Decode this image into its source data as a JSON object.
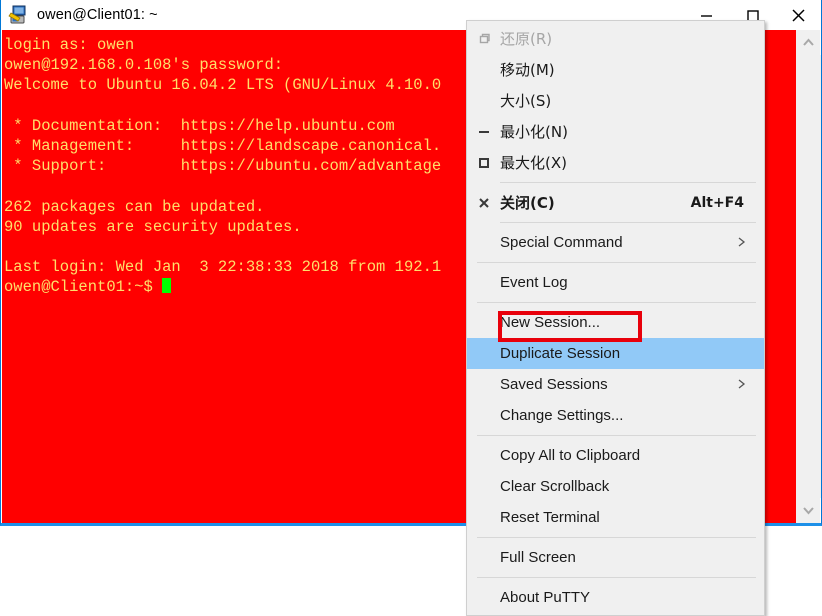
{
  "window": {
    "title": "owen@Client01: ~",
    "icon": "putty-computer-icon",
    "border_color": "#1e90e8",
    "titlebar_buttons": [
      {
        "name": "minimize-button",
        "glyph": "minimize-icon"
      },
      {
        "name": "maximize-button",
        "glyph": "maximize-icon"
      },
      {
        "name": "close-button",
        "glyph": "close-icon"
      }
    ]
  },
  "terminal": {
    "background_color": "#ff0000",
    "foreground_color": "#ffdf6b",
    "cursor_color": "#00ff00",
    "lines": [
      "login as: owen",
      "owen@192.168.0.108's password:",
      "Welcome to Ubuntu 16.04.2 LTS (GNU/Linux 4.10.0",
      "",
      " * Documentation:  https://help.ubuntu.com",
      " * Management:     https://landscape.canonical.",
      " * Support:        https://ubuntu.com/advantage",
      "",
      "262 packages can be updated.",
      "90 updates are security updates.",
      "",
      "Last login: Wed Jan  3 22:38:33 2018 from 192.1"
    ],
    "prompt": "owen@Client01:~$ "
  },
  "scrollbar": {
    "up_arrow": "chevron-up-icon",
    "down_arrow": "chevron-down-icon"
  },
  "context_menu": {
    "highlight_color": "#91c9f7",
    "items": [
      {
        "label": "还原(R)",
        "glyph": "restore-icon",
        "accel": "",
        "submenu": false,
        "disabled": true,
        "highlight": false,
        "zh": true
      },
      {
        "label": "移动(M)",
        "glyph": "",
        "accel": "",
        "submenu": false,
        "disabled": false,
        "highlight": false,
        "zh": true
      },
      {
        "label": "大小(S)",
        "glyph": "",
        "accel": "",
        "submenu": false,
        "disabled": false,
        "highlight": false,
        "zh": true
      },
      {
        "label": "最小化(N)",
        "glyph": "minimize-icon",
        "accel": "",
        "submenu": false,
        "disabled": false,
        "highlight": false,
        "zh": true
      },
      {
        "label": "最大化(X)",
        "glyph": "maximize-icon",
        "accel": "",
        "submenu": false,
        "disabled": false,
        "highlight": false,
        "zh": true
      },
      {
        "separator": true
      },
      {
        "label": "关闭(C)",
        "glyph": "close-icon",
        "accel": "Alt+F4",
        "submenu": false,
        "disabled": false,
        "highlight": false,
        "zh": true,
        "bold": true
      },
      {
        "separator": true
      },
      {
        "label": "Special Command",
        "glyph": "",
        "accel": "",
        "submenu": true,
        "disabled": false,
        "highlight": false
      },
      {
        "separator": true
      },
      {
        "label": "Event Log",
        "glyph": "",
        "accel": "",
        "submenu": false,
        "disabled": false,
        "highlight": false
      },
      {
        "separator": true
      },
      {
        "label": "New Session...",
        "glyph": "",
        "accel": "",
        "submenu": false,
        "disabled": false,
        "highlight": false
      },
      {
        "label": "Duplicate Session",
        "glyph": "",
        "accel": "",
        "submenu": false,
        "disabled": false,
        "highlight": true
      },
      {
        "label": "Saved Sessions",
        "glyph": "",
        "accel": "",
        "submenu": true,
        "disabled": false,
        "highlight": false
      },
      {
        "label": "Change Settings...",
        "glyph": "",
        "accel": "",
        "submenu": false,
        "disabled": false,
        "highlight": false
      },
      {
        "separator": true
      },
      {
        "label": "Copy All to Clipboard",
        "glyph": "",
        "accel": "",
        "submenu": false,
        "disabled": false,
        "highlight": false
      },
      {
        "label": "Clear Scrollback",
        "glyph": "",
        "accel": "",
        "submenu": false,
        "disabled": false,
        "highlight": false
      },
      {
        "label": "Reset Terminal",
        "glyph": "",
        "accel": "",
        "submenu": false,
        "disabled": false,
        "highlight": false
      },
      {
        "separator": true
      },
      {
        "label": "Full Screen",
        "glyph": "",
        "accel": "",
        "submenu": false,
        "disabled": false,
        "highlight": false
      },
      {
        "separator": true
      },
      {
        "label": "About PuTTY",
        "glyph": "",
        "accel": "",
        "submenu": false,
        "disabled": false,
        "highlight": false
      }
    ]
  },
  "annotation": {
    "target_label": "Change Settings...",
    "color": "#e8000b"
  }
}
